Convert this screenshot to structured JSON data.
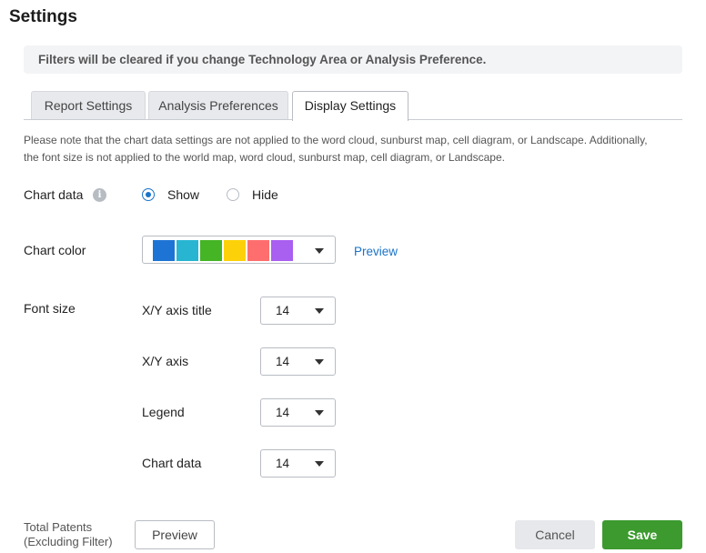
{
  "page": {
    "title": "Settings"
  },
  "notice": {
    "text": "Filters will be cleared if you change Technology Area or Analysis Preference."
  },
  "tabs": [
    {
      "label": "Report Settings",
      "active": false
    },
    {
      "label": "Analysis Preferences",
      "active": false
    },
    {
      "label": "Display Settings",
      "active": true
    }
  ],
  "note": {
    "line1": "Please note that the chart data settings are not applied to the word cloud, sunburst map, cell diagram, or Landscape. Additionally,",
    "line2": "the font size is not applied to the world map, word cloud, sunburst map, cell diagram, or Landscape."
  },
  "chart_data_setting": {
    "label": "Chart data",
    "options": [
      {
        "label": "Show",
        "checked": true
      },
      {
        "label": "Hide",
        "checked": false
      }
    ]
  },
  "chart_color": {
    "label": "Chart color",
    "swatches": [
      "#1e74d4",
      "#27b5d1",
      "#45b425",
      "#fcd109",
      "#ff6e6e",
      "#a95ff0"
    ],
    "preview_label": "Preview"
  },
  "font_size": {
    "label": "Font size",
    "rows": [
      {
        "label": "X/Y axis title",
        "value": "14"
      },
      {
        "label": "X/Y axis",
        "value": "14"
      },
      {
        "label": "Legend",
        "value": "14"
      },
      {
        "label": "Chart data",
        "value": "14"
      }
    ]
  },
  "footer": {
    "total_line1": "Total Patents",
    "total_line2": "(Excluding Filter)",
    "preview_label": "Preview",
    "cancel_label": "Cancel",
    "save_label": "Save"
  }
}
